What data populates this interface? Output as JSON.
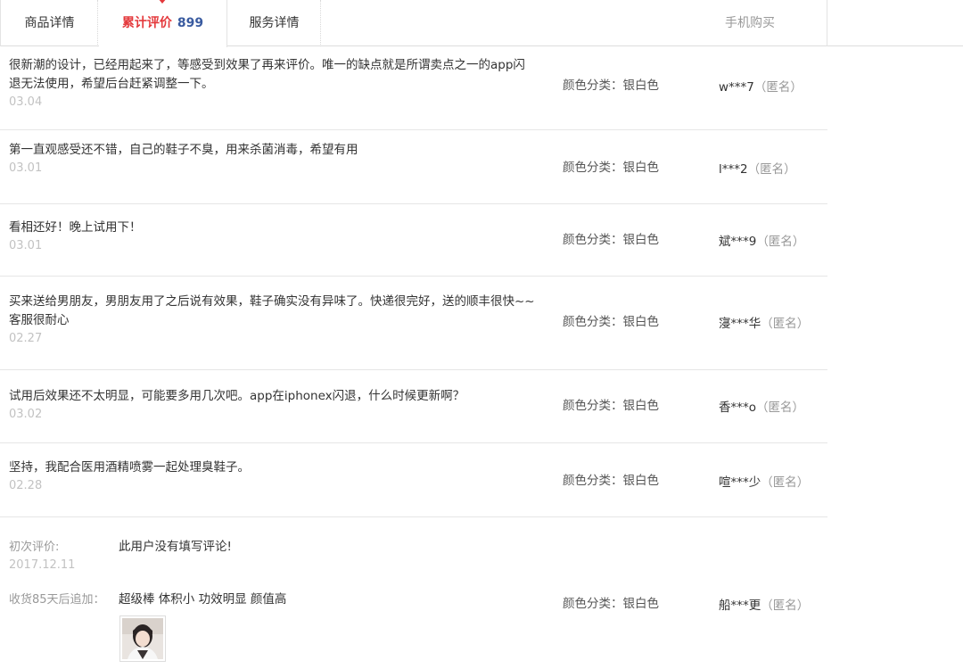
{
  "tabs": {
    "details": "商品详情",
    "reviews": "累计评价",
    "review_count": "899",
    "service": "服务详情",
    "mobile": "手机购买"
  },
  "reviews": [
    {
      "content": "很新潮的设计，已经用起来了，等感受到效果了再来评价。唯一的缺点就是所谓卖点之一的app闪退无法使用，希望后台赶紧调整一下。",
      "date": "03.04",
      "sku": "颜色分类：银白色",
      "user": "w***7",
      "anon": "（匿名）"
    },
    {
      "content": "第一直观感受还不错，自己的鞋子不臭，用来杀菌消毒，希望有用",
      "date": "03.01",
      "sku": "颜色分类：银白色",
      "user": "l***2",
      "anon": "（匿名）"
    },
    {
      "content": "看相还好！晚上试用下！",
      "date": "03.01",
      "sku": "颜色分类：银白色",
      "user": "斌***9",
      "anon": "（匿名）"
    },
    {
      "content": "买来送给男朋友，男朋友用了之后说有效果，鞋子确实没有异味了。快递很完好，送的顺丰很快~~ 客服很耐心",
      "date": "02.27",
      "sku": "颜色分类：银白色",
      "user": "寖***华",
      "anon": "（匿名）"
    },
    {
      "content": "试用后效果还不太明显，可能要多用几次吧。app在iphonex闪退，什么时候更新啊？",
      "date": "03.02",
      "sku": "颜色分类：银白色",
      "user": "香***o",
      "anon": "（匿名）"
    },
    {
      "content": "坚持，我配合医用酒精喷雾一起处理臭鞋子。",
      "date": "02.28",
      "sku": "颜色分类：银白色",
      "user": "喧***少",
      "anon": "（匿名）"
    }
  ],
  "followup": {
    "initial_label": "初次评价:",
    "initial_text": "此用户没有填写评论!",
    "initial_date": "2017.12.11",
    "append_label": "收货85天后追加：",
    "append_text": "超级棒 体积小 功效明显 颜值高",
    "sku": "颜色分类：银白色",
    "user": "船***更",
    "anon": "（匿名）"
  },
  "icons": {
    "thumbnail": "review-photo-thumbnail"
  },
  "colors": {
    "active_tab": "#e4393c",
    "count": "#3a5ba0",
    "muted": "#999999",
    "date": "#c2c2c2"
  }
}
